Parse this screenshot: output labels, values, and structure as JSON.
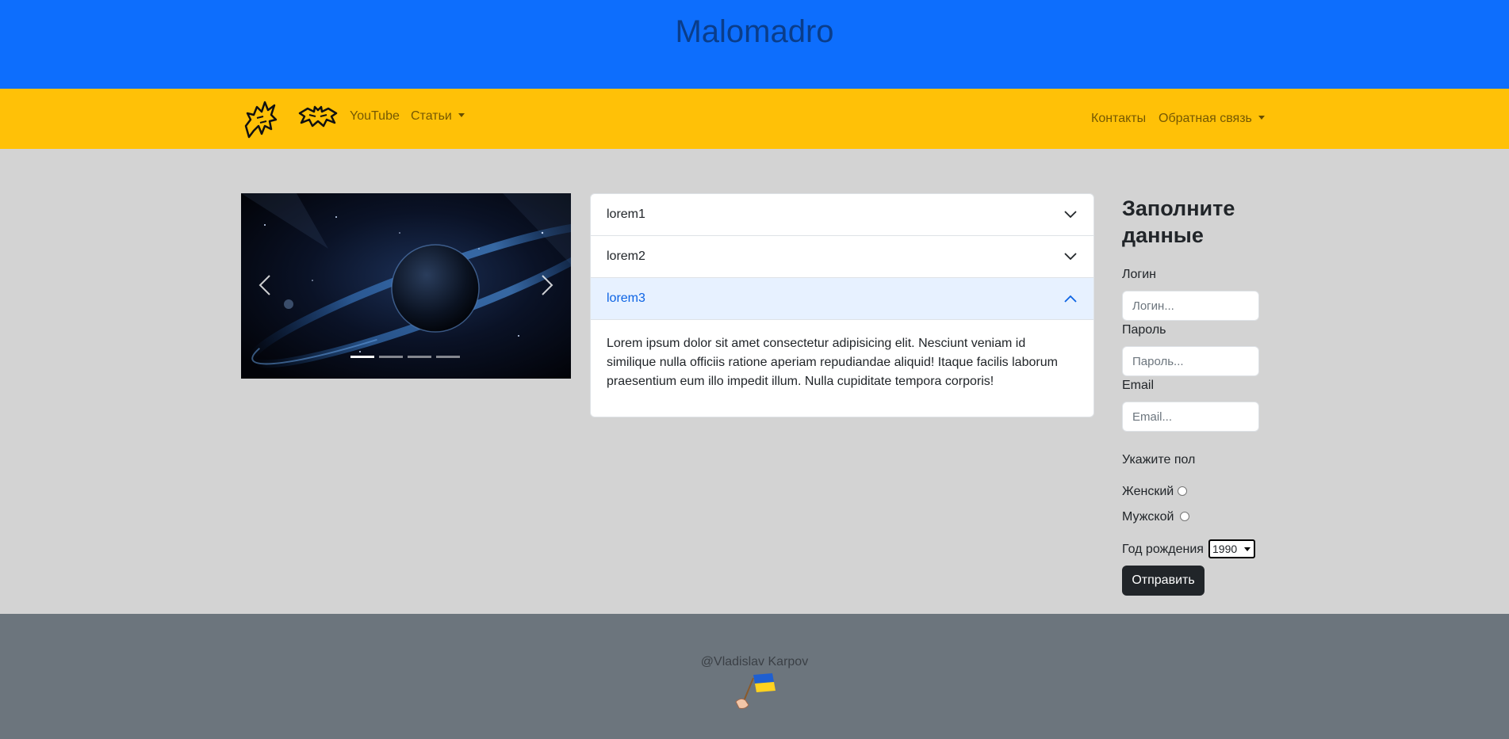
{
  "header": {
    "title": "Malomadro"
  },
  "nav": {
    "left_links": [
      "YouTube",
      "Статьи"
    ],
    "right_links": [
      "Контакты",
      "Обратная связь"
    ]
  },
  "carousel": {
    "indicator_count": 4,
    "active_index": 0
  },
  "accordion": {
    "items": [
      {
        "title": "lorem1",
        "expanded": false
      },
      {
        "title": "lorem2",
        "expanded": false
      },
      {
        "title": "lorem3",
        "expanded": true
      }
    ],
    "open_body": "Lorem ipsum dolor sit amet consectetur adipisicing elit. Nesciunt veniam id similique nulla officiis ratione aperiam repudiandae aliquid! Itaque facilis laborum praesentium eum illo impedit illum. Nulla cupiditate tempora corporis!"
  },
  "form": {
    "title": "Заполните данные",
    "login_label": "Логин",
    "login_placeholder": "Логин...",
    "password_label": "Пароль",
    "password_placeholder": "Пароль...",
    "email_label": "Email",
    "email_placeholder": "Email...",
    "gender_label": "Укажите пол",
    "gender_female": "Женский",
    "gender_male": "Мужской",
    "birth_year_label": "Год рождения",
    "birth_year_value": "1990",
    "submit_label": "Отправить"
  },
  "footer": {
    "author": "@Vladislav Karpov"
  },
  "colors": {
    "header_bg": "#0d6efd",
    "navbar_bg": "#ffc107",
    "page_bg": "#d3d3d3",
    "footer_bg": "#6c757d",
    "accordion_active_bg": "#e7f1ff",
    "button_bg": "#212529"
  },
  "icons": {
    "nav_logo_1": "wolf-tribal-icon",
    "nav_logo_2": "bat-tribal-icon",
    "carousel_prev": "chevron-left-icon",
    "carousel_next": "chevron-right-icon",
    "accordion_collapsed": "chevron-down-icon",
    "accordion_expanded": "chevron-up-icon",
    "footer_flag": "ukraine-flag-icon"
  }
}
